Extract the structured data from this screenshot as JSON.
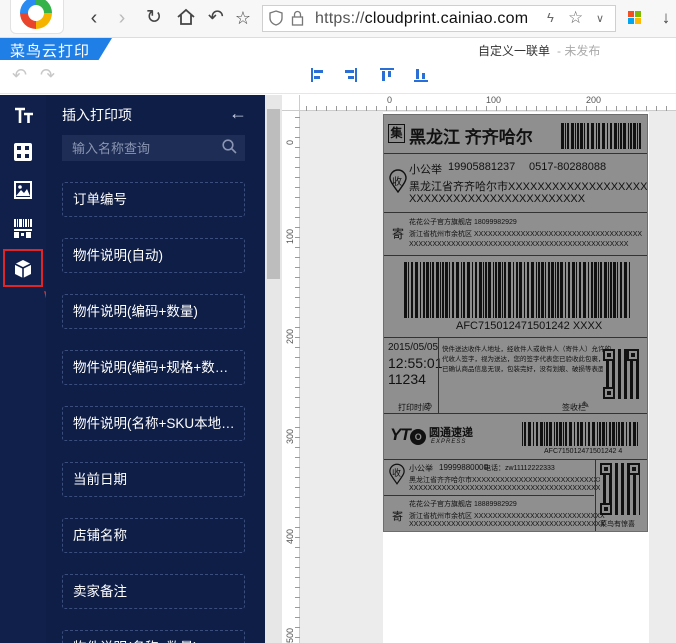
{
  "browser": {
    "url_prefix": "https://",
    "url_domain": "cloudprint.cainiao.com",
    "icons": [
      "back-icon",
      "forward-icon",
      "reload-icon",
      "home-icon",
      "undo-history-icon",
      "star-icon",
      "shield-icon",
      "lock-icon",
      "lightning-icon",
      "favorite-icon",
      "chevron-down-icon",
      "windows-icon",
      "download-icon"
    ]
  },
  "app": {
    "brand": "菜鸟云打印",
    "template_name": "自定义一联单",
    "publish_status": "- 未发布"
  },
  "sidebar": {
    "tools": [
      "text-tool-icon",
      "grid-tool-icon",
      "image-tool-icon",
      "barcode-tool-icon",
      "box-tool-icon"
    ]
  },
  "panel": {
    "title": "插入打印项",
    "search_placeholder": "输入名称查询",
    "items": [
      {
        "label": "订单编号"
      },
      {
        "label": "物件说明(自动)"
      },
      {
        "label": "物件说明(编码+数量)"
      },
      {
        "label": "物件说明(编码+规格+数…"
      },
      {
        "label": "物件说明(名称+SKU本地…"
      },
      {
        "label": "当前日期"
      },
      {
        "label": "店铺名称"
      },
      {
        "label": "卖家备注"
      },
      {
        "label": "物件说明(名称+数量)"
      }
    ]
  },
  "rulers": {
    "top": [
      "0",
      "100",
      "200"
    ],
    "left": [
      "0",
      "100",
      "200",
      "300",
      "400",
      "500"
    ]
  },
  "label": {
    "ji_mark": "集",
    "dest_city": "黑龙江 齐齐哈尔",
    "recipient_mark": "收",
    "recipient_name": "小公举",
    "recipient_phone": "19905881237",
    "recipient_tel": "0517-80288088",
    "recipient_addr_1": "黑龙江省齐齐哈尔市XXXXXXXXXXXXXXXXXXXXXXXX",
    "recipient_addr_2": "XXXXXXXXXXXXXXXXXXXXXXXX",
    "sender_mark": "寄",
    "sender_line_1": "花花公子官方旗舰店  18099982929",
    "sender_line_2": "浙江省杭州市余杭区 XXXXXXXXXXXXXXXXXXXXXXXXXXXXXXXXXXXX",
    "sender_line_3": "XXXXXXXXXXXXXXXXXXXXXXXXXXXXXXXXXXXXXXXXXXXXXXX",
    "tracking_no": "AFC715012471501242 XXXX",
    "date": "2015/05/05",
    "time": "12:55:01",
    "number": "11234",
    "terms_1": "快件送达收件人地址，经收件人或收件人（寄件人）允许的",
    "terms_2": "代收人签字，视为送达，您的签字代表您已验收此包裹，并",
    "terms_3": "已确认商品信息无误，包装完好，没有划痕、破损等表面质量",
    "print_time_label": "打印时间",
    "sign_label": "签收栏",
    "yto_name": "圆通速递",
    "yto_sub": "EXPRESS",
    "tracking_no_small": "AFC715012471501242 4",
    "r2_name": "小公举",
    "r2_phone": "19999880000",
    "r2_tel": "电话：zw11112222333",
    "r2_addr_1": "黑龙江省齐齐哈尔市XXXXXXXXXXXXXXXXXXXXXXXXXXXXXX",
    "r2_addr_2": "XXXXXXXXXXXXXXXXXXXXXXXXXXXXXXXXXXXXXXXXXXXXXX",
    "s2_line_1": "花花公子官方旗舰店  18889982929",
    "s2_line_2": "浙江省杭州市余杭区 XXXXXXXXXXXXXXXXXXXXXXXXXXXX",
    "s2_line_3": "XXXXXXXXXXXXXXXXXXXXXXXXXXXXXXXXXXXXXXXXXX",
    "scan_label": "菜鸟有惊喜"
  }
}
